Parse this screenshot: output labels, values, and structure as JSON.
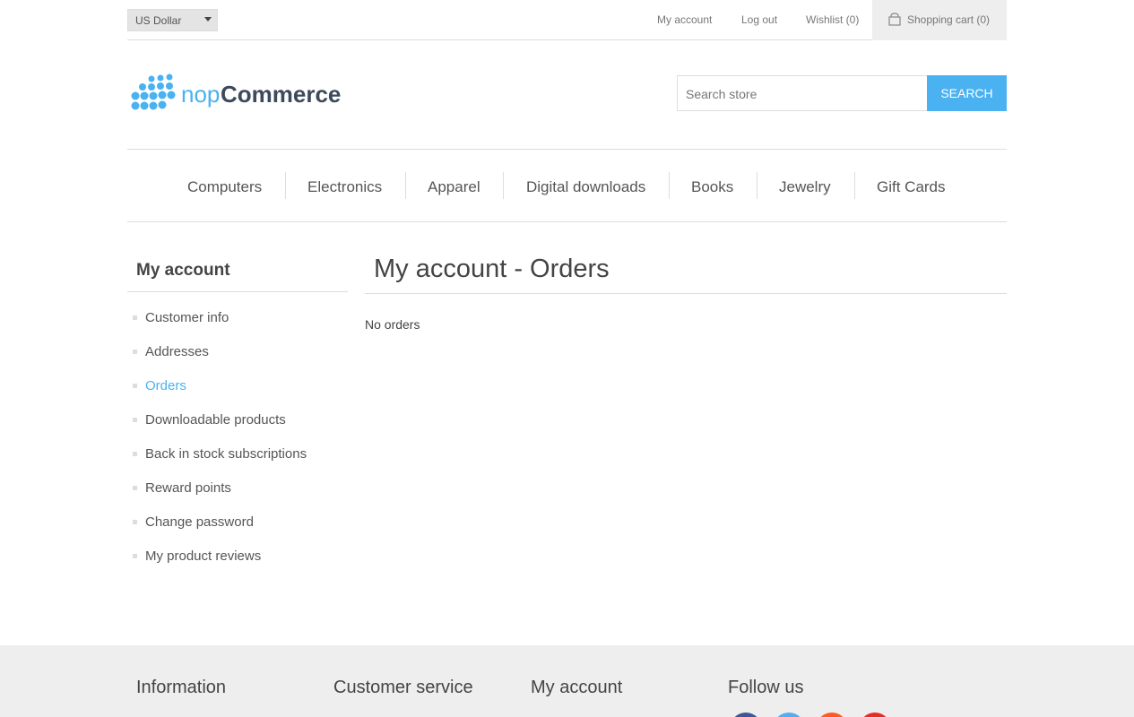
{
  "header": {
    "currency": "US Dollar",
    "links": {
      "my_account": "My account",
      "log_out": "Log out",
      "wishlist": "Wishlist (0)",
      "shopping_cart": "Shopping cart (0)"
    }
  },
  "logo": {
    "part1": "nop",
    "part2": "Commerce"
  },
  "search": {
    "placeholder": "Search store",
    "button": "Search"
  },
  "menu": [
    "Computers",
    "Electronics",
    "Apparel",
    "Digital downloads",
    "Books",
    "Jewelry",
    "Gift Cards"
  ],
  "sidebar": {
    "title": "My account",
    "items": [
      {
        "label": "Customer info"
      },
      {
        "label": "Addresses"
      },
      {
        "label": "Orders",
        "active": true
      },
      {
        "label": "Downloadable products"
      },
      {
        "label": "Back in stock subscriptions"
      },
      {
        "label": "Reward points"
      },
      {
        "label": "Change password"
      },
      {
        "label": "My product reviews"
      }
    ]
  },
  "main": {
    "title": "My account - Orders",
    "message": "No orders"
  },
  "footer": {
    "columns": [
      "Information",
      "Customer service",
      "My account",
      "Follow us"
    ],
    "social": [
      "facebook-icon",
      "twitter-icon",
      "rss-icon",
      "youtube-icon"
    ]
  },
  "colors": {
    "accent": "#4ab2f1",
    "facebook": "#3b5998",
    "twitter": "#55acee",
    "rss": "#fe5b21",
    "youtube": "#e52d27"
  }
}
